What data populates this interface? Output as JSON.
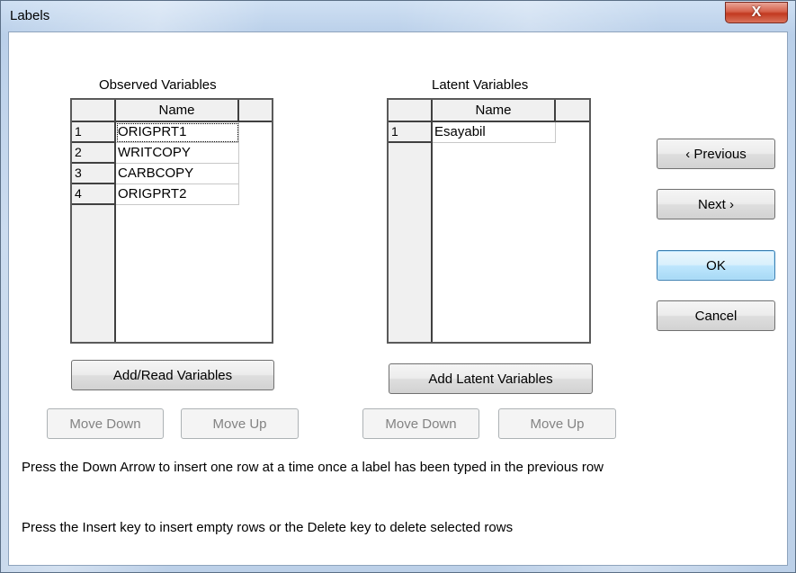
{
  "window": {
    "title": "Labels",
    "close_glyph": "X"
  },
  "observed": {
    "title": "Observed Variables",
    "column_header": "Name",
    "rows": [
      {
        "num": "1",
        "name": "ORIGPRT1"
      },
      {
        "num": "2",
        "name": "WRITCOPY"
      },
      {
        "num": "3",
        "name": "CARBCOPY"
      },
      {
        "num": "4",
        "name": "ORIGPRT2"
      }
    ],
    "add_button": "Add/Read Variables",
    "move_down": "Move Down",
    "move_up": "Move Up"
  },
  "latent": {
    "title": "Latent Variables",
    "column_header": "Name",
    "rows": [
      {
        "num": "1",
        "name": "Esayabil"
      }
    ],
    "add_button": "Add Latent Variables",
    "move_down": "Move Down",
    "move_up": "Move Up"
  },
  "nav": {
    "previous": "‹ Previous",
    "next": "Next ›",
    "ok": "OK",
    "cancel": "Cancel"
  },
  "hints": {
    "line1": "Press the Down Arrow to insert one row at a time once a label has been typed in the previous row",
    "line2": "Press the Insert key to insert empty rows or the Delete key to delete selected rows"
  }
}
